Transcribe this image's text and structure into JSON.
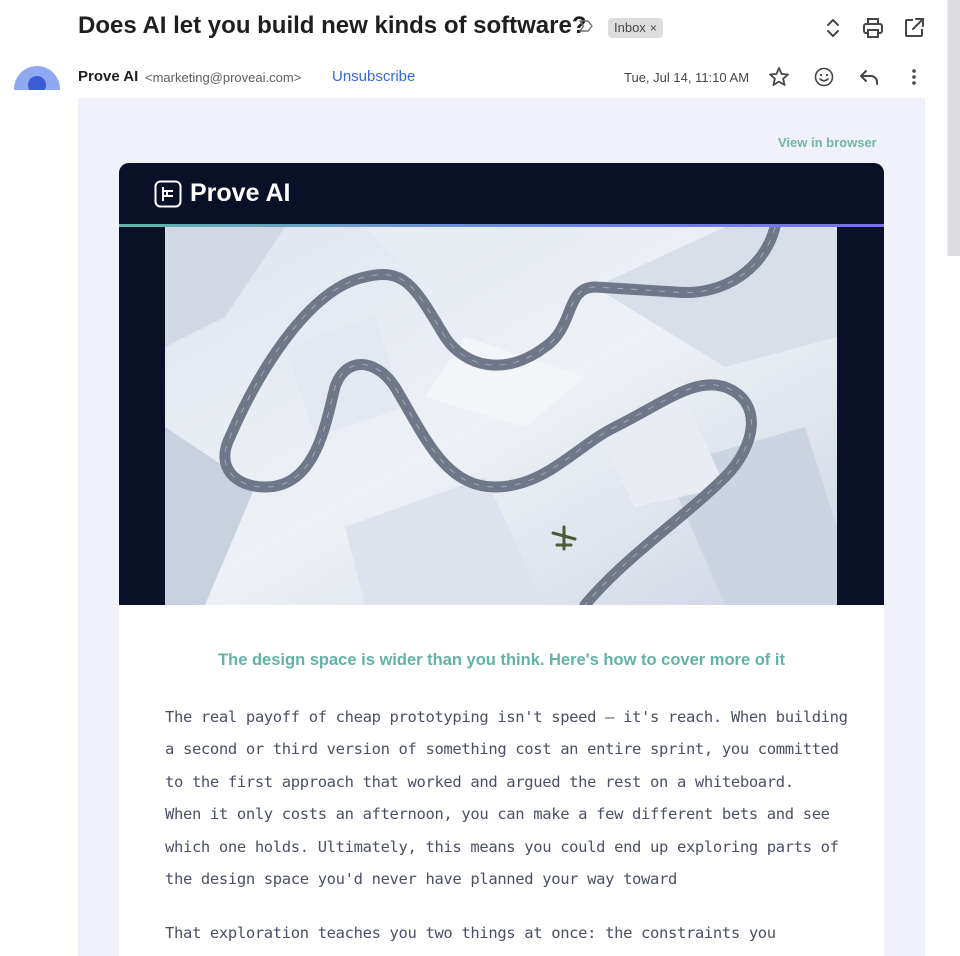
{
  "email": {
    "subject": "Does AI let you build new kinds of software?",
    "label_chip": "Inbox",
    "label_chip_close": "×",
    "sender_name": "Prove AI",
    "sender_email": "<marketing@proveai.com>",
    "unsubscribe_label": "Unsubscribe",
    "date": "Tue, Jul 14, 11:10 AM"
  },
  "icons": {
    "important": "important-marker-icon",
    "navigate": "up-down-arrows-icon",
    "print": "print-icon",
    "open_new": "open-in-new-window-icon",
    "star": "star-icon",
    "emoji": "emoji-icon",
    "reply": "reply-icon",
    "more": "more-vertical-icon"
  },
  "body": {
    "view_in_browser": "View in browser",
    "brand_name": "Prove AI",
    "headline": "The design space is wider than you think. Here's how to cover more of it",
    "paragraph1_lines": [
      "The real payoff of cheap prototyping isn't speed — it's reach. When building",
      "a second or third version of something cost an entire sprint, you committed",
      "to the first approach that worked and argued the rest on a whiteboard.",
      "When it only costs an afternoon, you can make a few different bets and see",
      "which one holds. Ultimately, this means you could end up exploring parts of",
      "the design space you'd never have planned your way toward"
    ],
    "paragraph2_lines": [
      "That exploration teaches you two things at once: the constraints you"
    ]
  },
  "colors": {
    "accent_teal": "#63b2a7",
    "header_navy": "#0b1029",
    "link_blue": "#3b66d6",
    "mail_background": "#f0f1fb"
  }
}
